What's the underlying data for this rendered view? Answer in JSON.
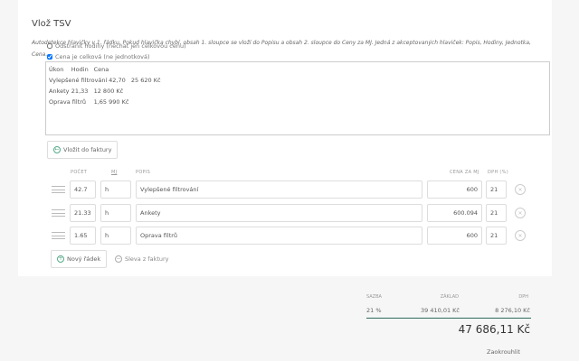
{
  "title": "Vlož TSV",
  "description": "Autodetekce hlavičky v 1. řádku. Pokud hlavička chybí, obsah 1. sloupce se vloží do Popisu a obsah 2. sloupce do Ceny za MJ. Jedná z akceptovaných hlaviček: Popis, Hodiny, Jednotka, Cena.",
  "options": [
    {
      "label": "Odstranit hodiny (nechat jen celkovou cenu)",
      "checked": false
    },
    {
      "label": "Cena je celková (ne jednotková)",
      "checked": true
    }
  ],
  "tsv": "Úkon\tHodin\tCena\nVylepšené filtrování\t42,70\t25 620 Kč\nAnkety\t21,33\t12 800 Kč\nOprava filtrů\t1,65\t990 Kč",
  "insert_button": "Vložit do faktury",
  "columns": {
    "count": "POČET",
    "unit": "MJ",
    "desc": "POPIS",
    "price": "CENA ZA MJ",
    "vat": "DPH (%)"
  },
  "rows": [
    {
      "count": "42.7",
      "unit": "h",
      "desc": "Vylepšené filtrování",
      "price": "600",
      "vat": "21"
    },
    {
      "count": "21.33",
      "unit": "h",
      "desc": "Ankety",
      "price": "600.094",
      "vat": "21"
    },
    {
      "count": "1.65",
      "unit": "h",
      "desc": "Oprava filtrů",
      "price": "600",
      "vat": "21"
    }
  ],
  "new_row_button": "Nový řádek",
  "discount_button": "Sleva z faktury",
  "summary": {
    "headers": [
      "SAZBA",
      "ZÁKLAD",
      "DPH"
    ],
    "rate": "21 %",
    "base": "39 410,01 Kč",
    "vat": "8 276,10 Kč",
    "total": "47 686,11 Kč",
    "round_button": "Zaokrouhlit"
  },
  "accent": "#2e6b5e"
}
